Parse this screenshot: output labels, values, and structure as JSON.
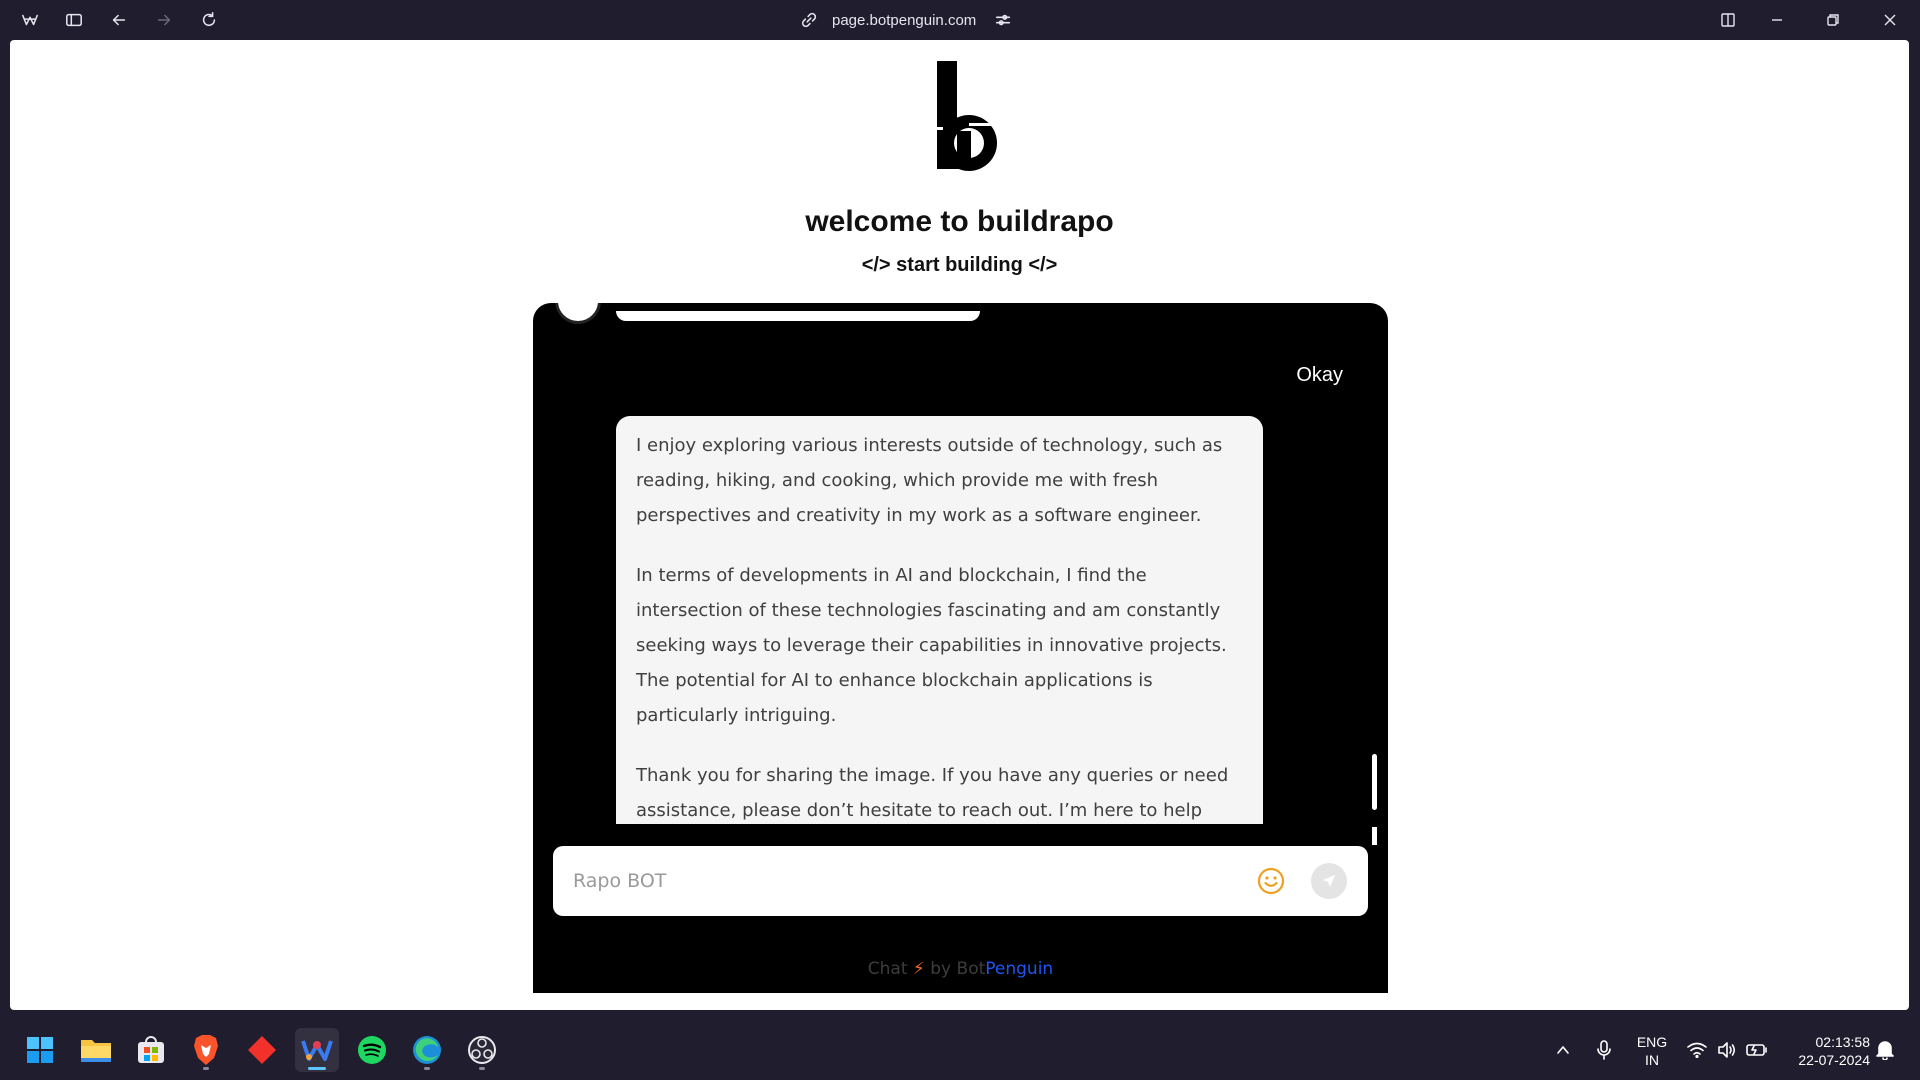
{
  "browser": {
    "url": "page.botpenguin.com"
  },
  "page": {
    "title": "welcome to buildrapo",
    "tagline": "</> start building </>"
  },
  "chat": {
    "user_message": "Okay",
    "bot_paragraphs": [
      "I enjoy exploring various interests outside of technology, such as reading, hiking, and cooking, which provide me with fresh perspectives and creativity in my work as a software engineer.",
      "In terms of developments in AI and blockchain, I find the intersection of these technologies fascinating and am constantly seeking ways to leverage their capabilities in innovative projects. The potential for AI to enhance blockchain applications is particularly intriguing.",
      "Thank you for sharing the image. If you have any queries or need assistance, please don’t hesitate to reach out. I’m here to help with"
    ],
    "input_placeholder": "Rapo BOT",
    "powered_by": {
      "chat": "Chat",
      "by": " by ",
      "brand_part1": "Bot",
      "brand_part2": "Penguin"
    }
  },
  "taskbar": {
    "apps": [
      "windows-start",
      "file-explorer",
      "microsoft-store",
      "brave",
      "git-tool",
      "wavebox",
      "spotify",
      "edge",
      "obs"
    ]
  },
  "tray": {
    "lang_line1": "ENG",
    "lang_line2": "IN",
    "time": "02:13:58",
    "date": "22-07-2024"
  },
  "colors": {
    "browser_chrome": "#201d2e",
    "chat_background": "#000000",
    "bot_bubble": "#f5f5f5",
    "brand_blue": "#1e55f5",
    "accent_orange": "#f06a1b"
  }
}
